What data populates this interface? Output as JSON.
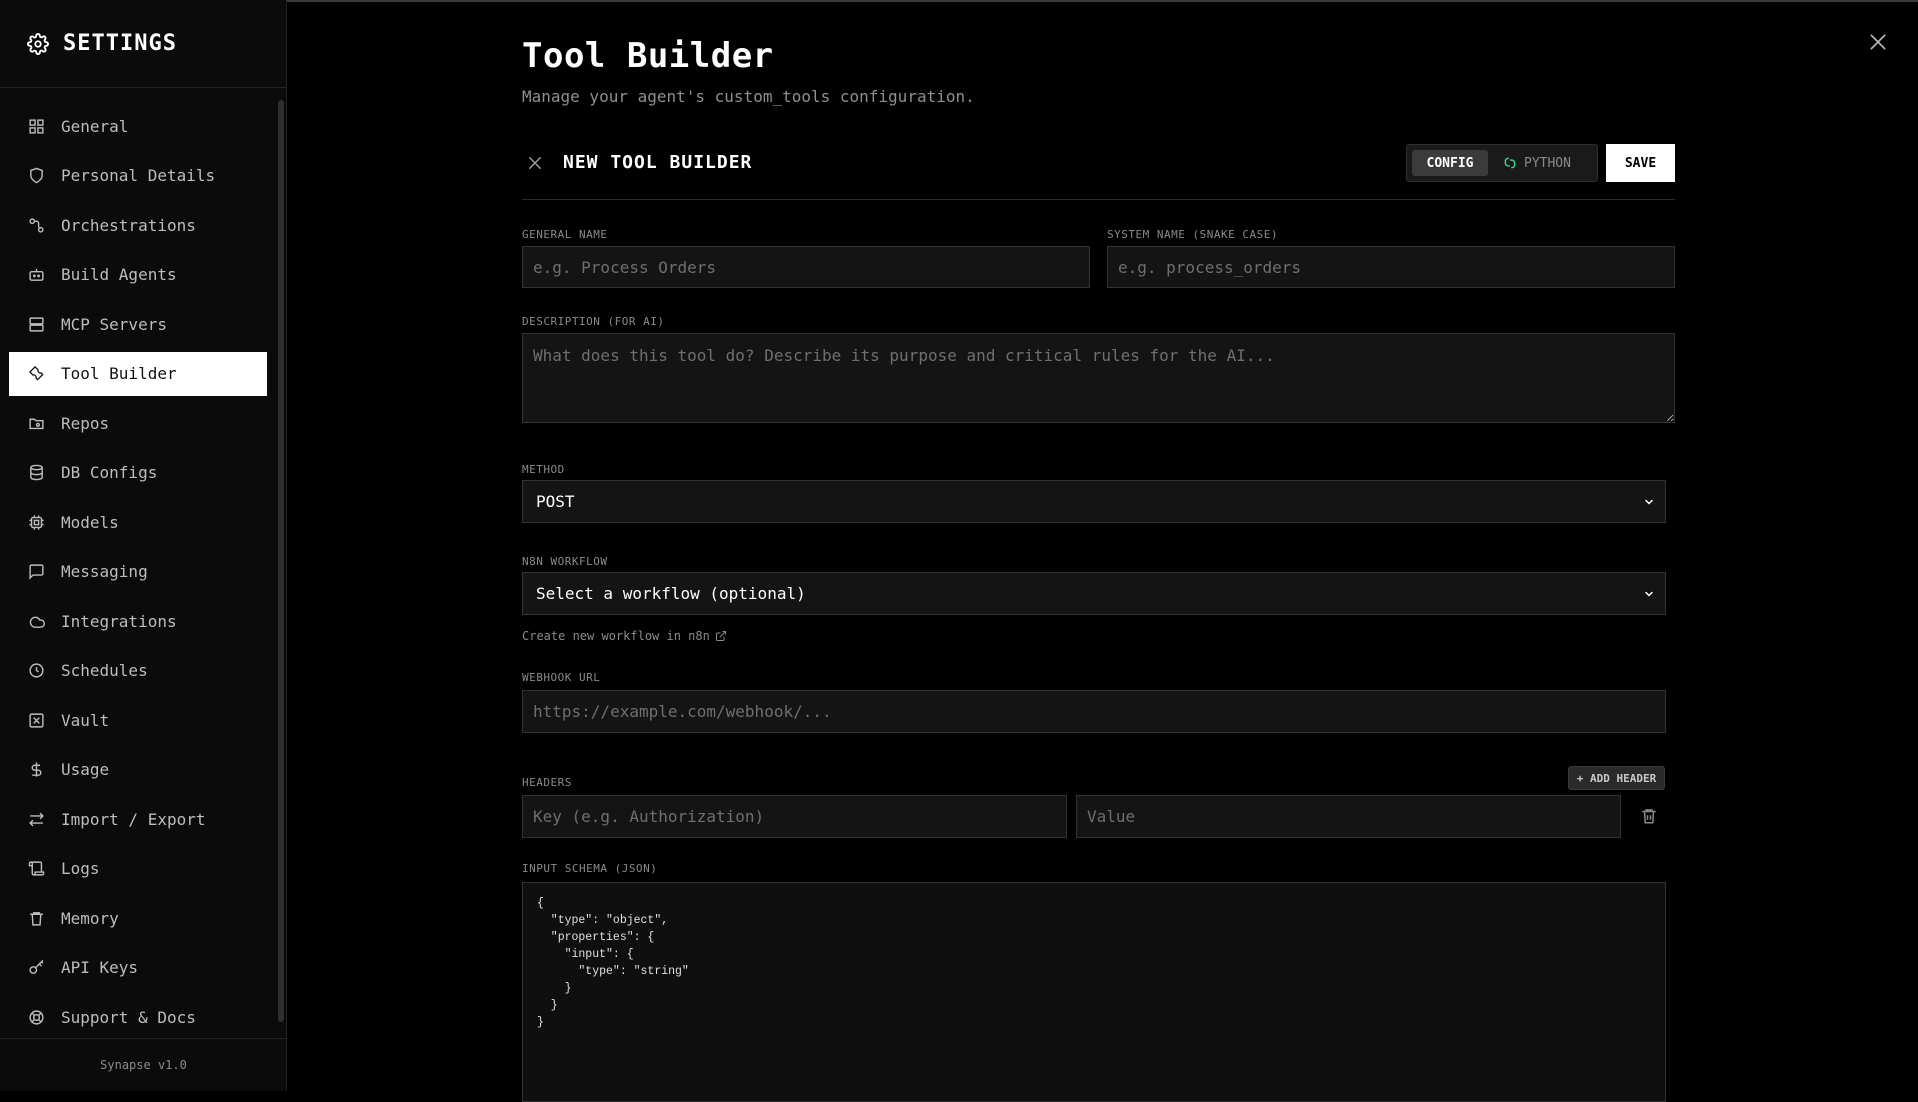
{
  "sidebar": {
    "title": "SETTINGS",
    "items": [
      {
        "label": "General",
        "icon": "grid-icon"
      },
      {
        "label": "Personal Details",
        "icon": "shield-icon"
      },
      {
        "label": "Orchestrations",
        "icon": "workflow-icon"
      },
      {
        "label": "Build Agents",
        "icon": "bot-icon"
      },
      {
        "label": "MCP Servers",
        "icon": "server-icon"
      },
      {
        "label": "Tool Builder",
        "icon": "wrench-icon",
        "active": true
      },
      {
        "label": "Repos",
        "icon": "folder-git-icon"
      },
      {
        "label": "DB Configs",
        "icon": "database-icon"
      },
      {
        "label": "Models",
        "icon": "cpu-icon"
      },
      {
        "label": "Messaging",
        "icon": "message-icon"
      },
      {
        "label": "Integrations",
        "icon": "cloud-icon"
      },
      {
        "label": "Schedules",
        "icon": "clock-icon"
      },
      {
        "label": "Vault",
        "icon": "vault-icon"
      },
      {
        "label": "Usage",
        "icon": "dollar-icon"
      },
      {
        "label": "Import / Export",
        "icon": "arrows-icon"
      },
      {
        "label": "Logs",
        "icon": "scroll-icon"
      },
      {
        "label": "Memory",
        "icon": "trash-icon"
      },
      {
        "label": "API Keys",
        "icon": "key-icon"
      },
      {
        "label": "Support & Docs",
        "icon": "lifebuoy-icon"
      }
    ],
    "version": "Synapse v1.0"
  },
  "page": {
    "title": "Tool Builder",
    "subtitle": "Manage your agent's custom_tools configuration."
  },
  "builder": {
    "title": "NEW TOOL BUILDER",
    "toggle_config": "CONFIG",
    "toggle_python": "PYTHON",
    "save_label": "SAVE"
  },
  "form": {
    "general_name_label": "GENERAL NAME",
    "general_name_placeholder": "e.g. Process Orders",
    "general_name_value": "",
    "system_name_label": "SYSTEM NAME (SNAKE CASE)",
    "system_name_placeholder": "e.g. process_orders",
    "system_name_value": "",
    "description_label": "DESCRIPTION (FOR AI)",
    "description_placeholder": "What does this tool do? Describe its purpose and critical rules for the AI...",
    "method_label": "METHOD",
    "method_value": "POST",
    "workflow_label": "N8N WORKFLOW",
    "workflow_value": "Select a workflow (optional)",
    "workflow_link": "Create new workflow in n8n",
    "webhook_label": "WEBHOOK URL",
    "webhook_placeholder": "https://example.com/webhook/...",
    "headers_label": "HEADERS",
    "add_header_label": "+ ADD HEADER",
    "header_key_placeholder": "Key (e.g. Authorization)",
    "header_value_placeholder": "Value",
    "schema_label": "INPUT SCHEMA (JSON)",
    "schema_value": "{\n  \"type\": \"object\",\n  \"properties\": {\n    \"input\": {\n      \"type\": \"string\"\n    }\n  }\n}"
  },
  "colors": {
    "background": "#000000",
    "sidebar_bg": "#0b0b0b",
    "active_item_bg": "#ffffff",
    "accent_python": "#3ecf8e"
  }
}
